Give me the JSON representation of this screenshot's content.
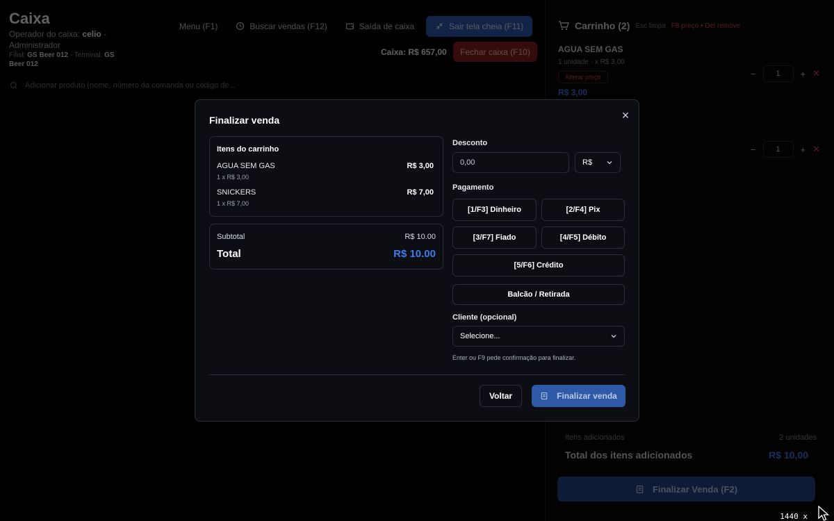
{
  "header": {
    "title": "Caixa",
    "operator_label": "Operador do caixa:",
    "operator_name": "celio",
    "operator_sep": " - ",
    "operator_role": "Administrador",
    "branch_label": "Filial:",
    "branch_name": "GS Beer 012",
    "terminal_label": " - Terminal:",
    "terminal_name": "GS Beer 012"
  },
  "nav": {
    "menu": "Menu  (F1)",
    "buscar": "Buscar vendas  (F12)",
    "saida": "Saída de caixa",
    "sair_tela": "Sair tela cheia (F11)",
    "caixa_value": "Caixa: R$ 657,00",
    "fechar": "Fechar caixa  (F10)"
  },
  "search": {
    "placeholder": "Adicionar produto (nome, número da comanda ou código de..."
  },
  "cart": {
    "title": "Carrinho (2)",
    "esc": "Esc limpa",
    "warn": "F8 preço • Del remove",
    "items": [
      {
        "name": "AGUA SEM GAS",
        "sub": "1 unidade · x R$ 3,00",
        "alter": "Alterar preço",
        "price": "R$ 3,00",
        "qty": "1"
      },
      {
        "qty": "1"
      }
    ],
    "added_label": "Itens adicionados",
    "added_value": "2 unidades",
    "total_label": "Total dos itens adicionados",
    "total_value": "R$ 10,00",
    "finalizar": "Finalizar Venda (F2)"
  },
  "screen": {
    "resolution": "1440 x"
  },
  "modal": {
    "title": "Finalizar venda",
    "items_header": "Itens do carrinho",
    "items": [
      {
        "name": "AGUA SEM GAS",
        "price": "R$ 3,00",
        "sub": "1 x R$ 3,00"
      },
      {
        "name": "SNICKERS",
        "price": "R$ 7,00",
        "sub": "1 x R$ 7,00"
      }
    ],
    "subtotal_label": "Subtotal",
    "subtotal_value": "R$ 10.00",
    "total_label": "Total",
    "total_value": "R$ 10.00",
    "discount_label": "Desconto",
    "discount_value": "0,00",
    "discount_unit": "R$",
    "payment_label": "Pagamento",
    "payments": {
      "dinheiro": "[1/F3] Dinheiro",
      "pix": "[2/F4] Pix",
      "fiado": "[3/F7] Fiado",
      "debito": "[4/F5] Débito",
      "credito": "[5/F6] Crédito"
    },
    "balcao": "Balcão / Retirada",
    "client_label": "Cliente (opcional)",
    "client_value": "Selecione...",
    "hint": "Enter ou F9 pede confirmação para finalizar.",
    "voltar": "Voltar",
    "finalizar": "Finalizar venda"
  }
}
